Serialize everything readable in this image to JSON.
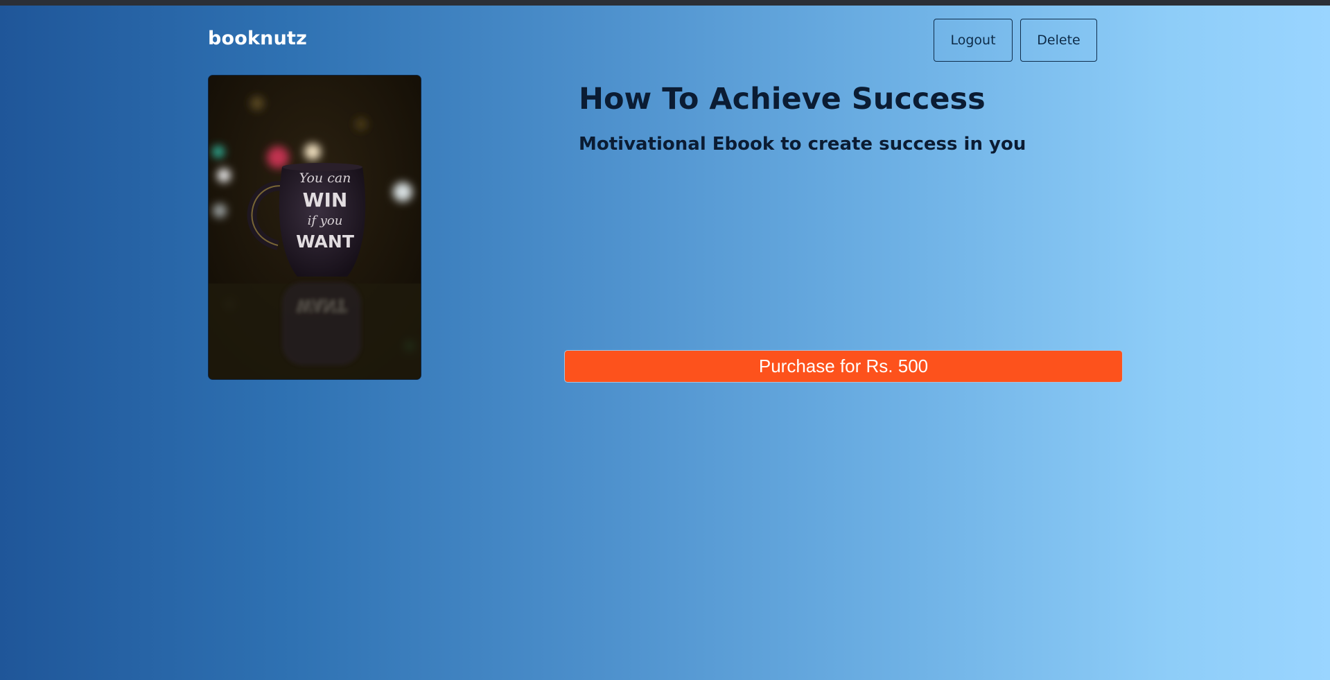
{
  "header": {
    "brand": "booknutz",
    "logout_label": "Logout",
    "delete_label": "Delete"
  },
  "book": {
    "title": "How To Achieve Success",
    "subtitle": "Motivational Ebook to create success in you",
    "cover": {
      "mug_text_1": "You can",
      "mug_text_2": "WIN",
      "mug_text_3": "if you",
      "mug_text_4": "WANT"
    },
    "purchase_label": "Purchase for Rs. 500"
  },
  "colors": {
    "purchase_button": "#fd521c",
    "gradient_start": "#1f5699",
    "gradient_end": "#9ad5ff",
    "text_dark": "#0b1c33"
  }
}
